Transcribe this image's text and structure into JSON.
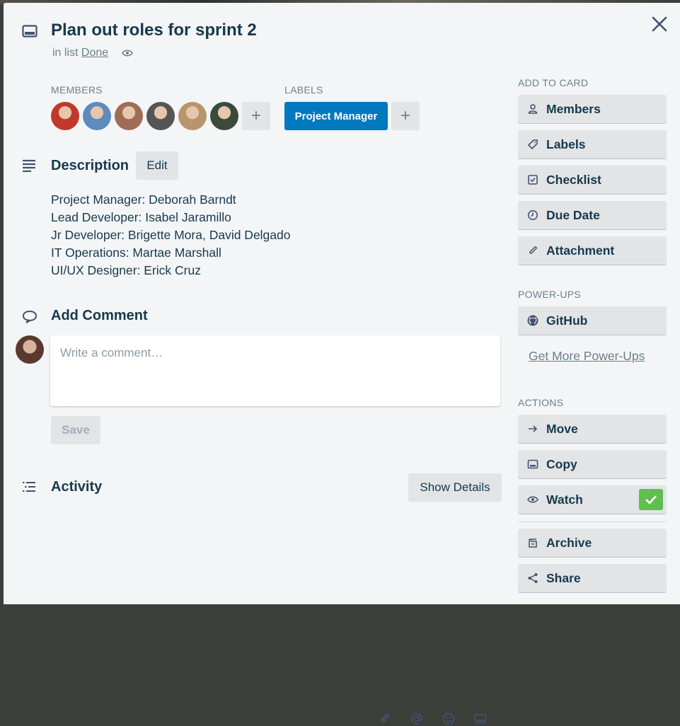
{
  "card": {
    "title": "Plan out roles for sprint 2",
    "in_list_prefix": "in list",
    "list_name": "Done"
  },
  "members": {
    "heading": "MEMBERS",
    "avatars": [
      {
        "name": "member-1",
        "bg": "#c0392b"
      },
      {
        "name": "member-2",
        "bg": "#5d8bbd"
      },
      {
        "name": "member-3",
        "bg": "#a06c55"
      },
      {
        "name": "member-4",
        "bg": "#555555"
      },
      {
        "name": "member-5",
        "bg": "#b8956a"
      },
      {
        "name": "member-6",
        "bg": "#3b4a3a"
      }
    ],
    "add_glyph": "+"
  },
  "labels": {
    "heading": "LABELS",
    "items": [
      {
        "text": "Project Manager",
        "color": "#0079bf"
      }
    ],
    "add_glyph": "+"
  },
  "description": {
    "heading": "Description",
    "edit_label": "Edit",
    "lines": [
      "Project Manager: Deborah Barndt",
      "Lead Developer: Isabel Jaramillo",
      "Jr Developer: Brigette Mora, David Delgado",
      "IT Operations: Martae Marshall",
      "UI/UX Designer: Erick Cruz"
    ]
  },
  "comment": {
    "heading": "Add Comment",
    "placeholder": "Write a comment…",
    "save_label": "Save",
    "tools": [
      "attachment-icon",
      "mention-icon",
      "emoji-icon",
      "card-icon"
    ]
  },
  "activity": {
    "heading": "Activity",
    "show_details_label": "Show Details"
  },
  "sidebar": {
    "add_to_card_heading": "ADD TO CARD",
    "add_to_card": [
      {
        "label": "Members",
        "icon": "person-icon"
      },
      {
        "label": "Labels",
        "icon": "tag-icon"
      },
      {
        "label": "Checklist",
        "icon": "checklist-icon"
      },
      {
        "label": "Due Date",
        "icon": "clock-icon"
      },
      {
        "label": "Attachment",
        "icon": "paperclip-icon"
      }
    ],
    "powerups_heading": "POWER-UPS",
    "powerups": [
      {
        "label": "GitHub",
        "icon": "github-icon"
      }
    ],
    "get_more_label": "Get More Power-Ups",
    "actions_heading": "ACTIONS",
    "actions": [
      {
        "label": "Move",
        "icon": "arrow-right-icon"
      },
      {
        "label": "Copy",
        "icon": "card-icon"
      },
      {
        "label": "Watch",
        "icon": "eye-icon",
        "checked": true
      },
      {
        "label": "Archive",
        "icon": "archive-icon"
      },
      {
        "label": "Share",
        "icon": "share-icon"
      }
    ]
  },
  "colors": {
    "accent": "#0079bf",
    "success": "#61bd4f",
    "text": "#17394d",
    "muted": "#6b808c",
    "button_bg": "#e2e4e6"
  }
}
